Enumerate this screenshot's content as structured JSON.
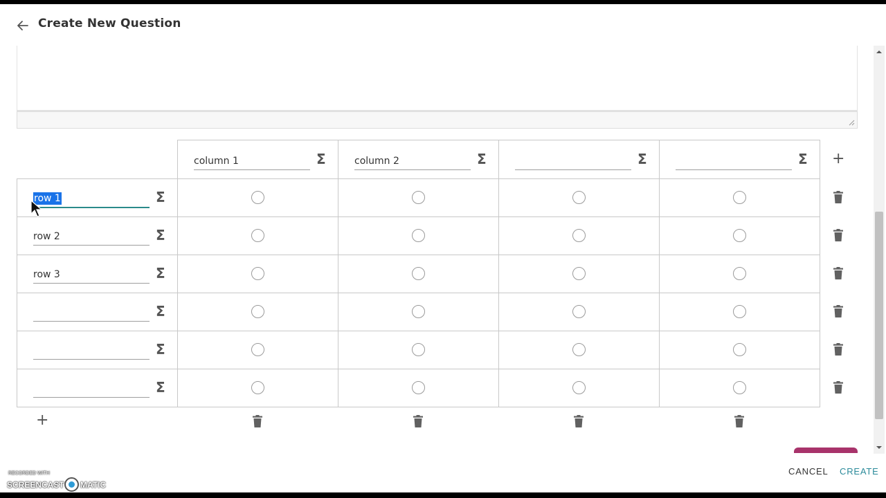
{
  "header": {
    "title": "Create New Question"
  },
  "grid": {
    "columns": [
      {
        "label": "column 1"
      },
      {
        "label": "column 2"
      },
      {
        "label": ""
      },
      {
        "label": ""
      }
    ],
    "rows": [
      {
        "label": "row 1",
        "selected_text": "row 1"
      },
      {
        "label": "row 2"
      },
      {
        "label": "row 3"
      },
      {
        "label": ""
      },
      {
        "label": ""
      },
      {
        "label": ""
      }
    ]
  },
  "footer": {
    "cancel_label": "CANCEL",
    "create_label": "CREATE"
  },
  "watermark": {
    "small": "RECORDED WITH",
    "left": "SCREENCAST",
    "right": "MATIC"
  },
  "icons": {
    "back": "arrow-left-icon",
    "sigma": "sigma-icon",
    "trash": "trash-icon",
    "plus": "plus-icon"
  },
  "colors": {
    "accent": "#2a8a9a",
    "selection": "#1a73e8",
    "brand_tab": "#a8336b"
  }
}
